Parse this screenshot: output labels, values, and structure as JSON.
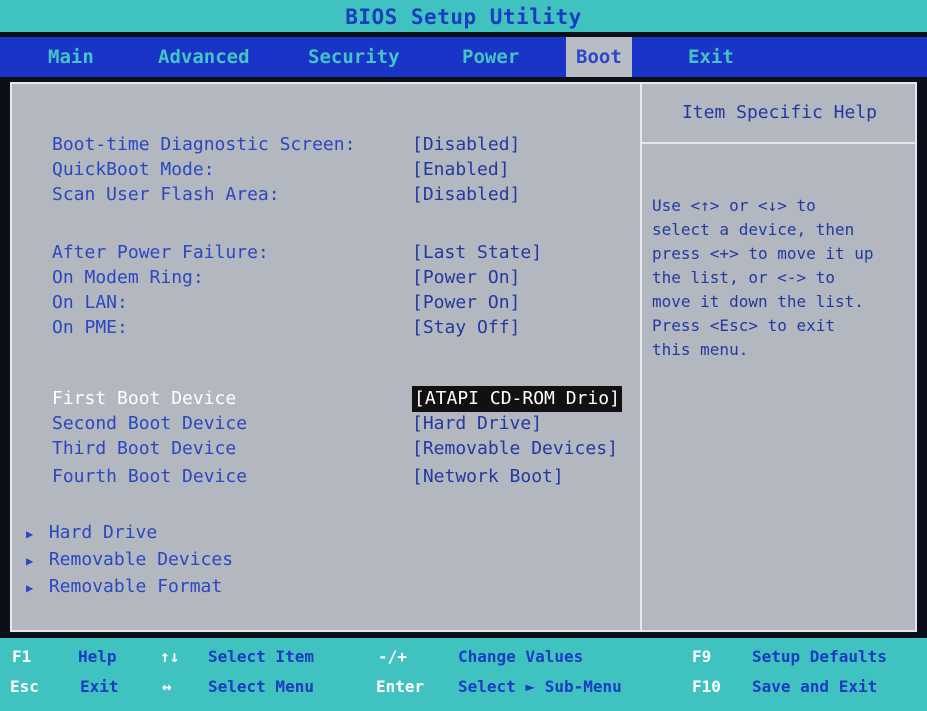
{
  "title": "BIOS Setup Utility",
  "menu": {
    "tabs": [
      "Main",
      "Advanced",
      "Security",
      "Power",
      "Boot",
      "Exit"
    ],
    "active": "Boot"
  },
  "settings": [
    {
      "label": "Boot-time Diagnostic Screen:",
      "value": "[Disabled]"
    },
    {
      "label": "QuickBoot Mode:",
      "value": "[Enabled]"
    },
    {
      "label": "Scan User Flash Area:",
      "value": "[Disabled]"
    },
    {
      "label": "After Power Failure:",
      "value": "[Last State]"
    },
    {
      "label": "On Modem Ring:",
      "value": "[Power On]"
    },
    {
      "label": "On LAN:",
      "value": "[Power On]"
    },
    {
      "label": "On PME:",
      "value": "[Stay Off]"
    },
    {
      "label": "First Boot Device",
      "value": "[ATAPI CD-ROM Drio]"
    },
    {
      "label": "Second Boot Device",
      "value": "[Hard Drive]"
    },
    {
      "label": "Third Boot Device",
      "value": "[Removable Devices]"
    },
    {
      "label": "Fourth Boot Device",
      "value": "[Network Boot]"
    }
  ],
  "submenus": [
    "Hard Drive",
    "Removable Devices",
    "Removable Format"
  ],
  "help": {
    "title": "Item Specific Help",
    "text": "Use <↑> or <↓> to\nselect a device, then\npress <+> to move it up\nthe list, or <-> to\nmove it down the list.\nPress <Esc> to exit\nthis menu."
  },
  "footer": {
    "row1": [
      {
        "key": "F1",
        "desc": "Help"
      },
      {
        "key": "↑↓",
        "desc": "Select Item"
      },
      {
        "key": "-/+",
        "desc": "Change Values"
      },
      {
        "key": "F9",
        "desc": "Setup Defaults"
      }
    ],
    "row2": [
      {
        "key": "Esc",
        "desc": "Exit"
      },
      {
        "key": "↔",
        "desc": "Select Menu"
      },
      {
        "key": "Enter",
        "desc": "Select ► Sub-Menu"
      },
      {
        "key": "F10",
        "desc": "Save and Exit"
      }
    ]
  },
  "colors": {
    "accent_cyan": "#3fc2c0",
    "menu_blue": "#1a34c8",
    "panel_gray": "#b3b7bf",
    "text_blue": "#2a48c0"
  }
}
